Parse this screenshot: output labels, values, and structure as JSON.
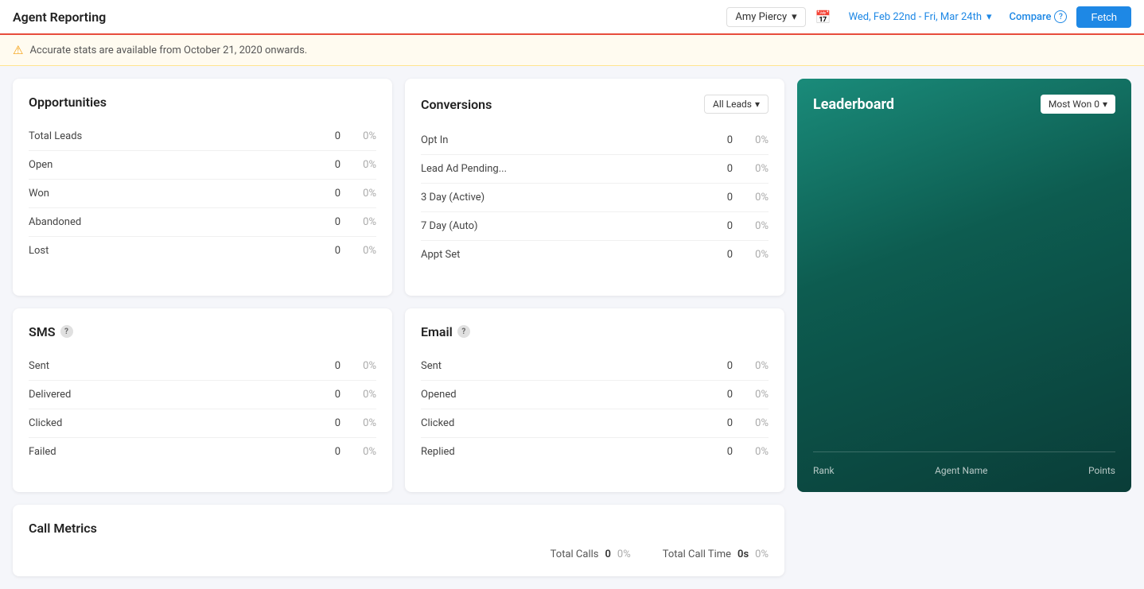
{
  "header": {
    "title": "Agent Reporting",
    "agent": "Amy Piercy",
    "date_range": "Wed, Feb 22nd - Fri, Mar 24th",
    "compare_label": "Compare",
    "fetch_label": "Fetch"
  },
  "alert": {
    "text": "Accurate stats are available from October 21, 2020 onwards."
  },
  "opportunities": {
    "title": "Opportunities",
    "rows": [
      {
        "label": "Total Leads",
        "value": "0",
        "pct": "0%"
      },
      {
        "label": "Open",
        "value": "0",
        "pct": "0%"
      },
      {
        "label": "Won",
        "value": "0",
        "pct": "0%"
      },
      {
        "label": "Abandoned",
        "value": "0",
        "pct": "0%"
      },
      {
        "label": "Lost",
        "value": "0",
        "pct": "0%"
      }
    ]
  },
  "conversions": {
    "title": "Conversions",
    "filter_label": "All Leads",
    "rows": [
      {
        "label": "Opt In",
        "value": "0",
        "pct": "0%"
      },
      {
        "label": "Lead Ad Pending...",
        "value": "0",
        "pct": "0%"
      },
      {
        "label": "3 Day (Active)",
        "value": "0",
        "pct": "0%"
      },
      {
        "label": "7 Day (Auto)",
        "value": "0",
        "pct": "0%"
      },
      {
        "label": "Appt Set",
        "value": "0",
        "pct": "0%"
      }
    ]
  },
  "leaderboard": {
    "title": "Leaderboard",
    "filter_label": "Most Won 0",
    "columns": {
      "rank": "Rank",
      "agent_name": "Agent Name",
      "points": "Points"
    }
  },
  "sms": {
    "title": "SMS",
    "rows": [
      {
        "label": "Sent",
        "value": "0",
        "pct": "0%"
      },
      {
        "label": "Delivered",
        "value": "0",
        "pct": "0%"
      },
      {
        "label": "Clicked",
        "value": "0",
        "pct": "0%"
      },
      {
        "label": "Failed",
        "value": "0",
        "pct": "0%"
      }
    ]
  },
  "email": {
    "title": "Email",
    "rows": [
      {
        "label": "Sent",
        "value": "0",
        "pct": "0%"
      },
      {
        "label": "Opened",
        "value": "0",
        "pct": "0%"
      },
      {
        "label": "Clicked",
        "value": "0",
        "pct": "0%"
      },
      {
        "label": "Replied",
        "value": "0",
        "pct": "0%"
      }
    ]
  },
  "call_metrics": {
    "title": "Call Metrics",
    "total_calls_label": "Total Calls",
    "total_calls_value": "0",
    "total_calls_pct": "0%",
    "total_call_time_label": "Total Call Time",
    "total_call_time_value": "0s",
    "total_call_time_pct": "0%"
  }
}
